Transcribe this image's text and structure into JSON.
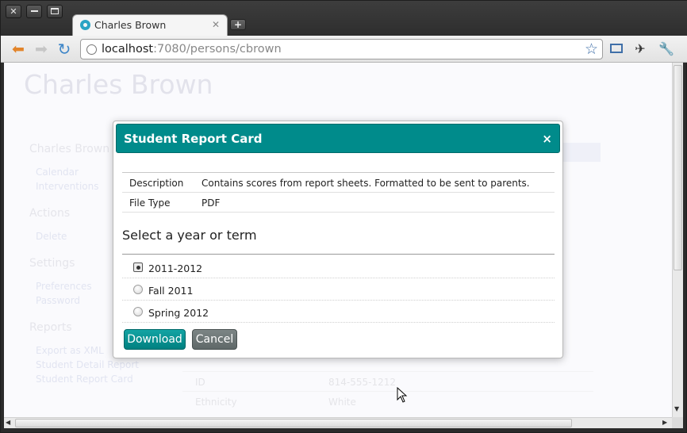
{
  "window": {
    "close_glyph": "✕",
    "tab": {
      "title": "Charles Brown",
      "close_glyph": "✕"
    },
    "newtab_glyph": "+"
  },
  "toolbar": {
    "back_glyph": "⬅",
    "forward_glyph": "➡",
    "reload_glyph": "↻",
    "url_host": "localhost",
    "url_rest": ":7080/persons/cbrown",
    "star_glyph": "☆",
    "pin_glyph": "✈",
    "wrench_glyph": "🔧"
  },
  "page": {
    "title": "Charles Brown",
    "sidebar": {
      "section1_title": "Charles Brown",
      "calendar": "Calendar",
      "interventions": "Interventions",
      "actions_title": "Actions",
      "delete": "Delete",
      "settings_title": "Settings",
      "preferences": "Preferences",
      "password": "Password",
      "reports_title": "Reports",
      "export_xml": "Export as XML",
      "student_detail_report": "Student Detail Report",
      "student_report_card": "Student Report Card"
    },
    "info": {
      "id_label": "ID",
      "id_value": "814-555-1212",
      "ethnicity_label": "Ethnicity",
      "ethnicity_value": "White"
    }
  },
  "modal": {
    "title": "Student Report Card",
    "close_glyph": "×",
    "details": [
      {
        "key": "Description",
        "value": "Contains scores from report sheets. Formatted to be sent to parents."
      },
      {
        "key": "File Type",
        "value": "PDF"
      }
    ],
    "section_title": "Select a year or term",
    "options": [
      {
        "label": "2011-2012",
        "selected": true
      },
      {
        "label": "Fall 2011",
        "selected": false
      },
      {
        "label": "Spring 2012",
        "selected": false
      }
    ],
    "download_label": "Download",
    "cancel_label": "Cancel"
  },
  "colors": {
    "accent": "#008b8b",
    "cancel": "#667070"
  }
}
